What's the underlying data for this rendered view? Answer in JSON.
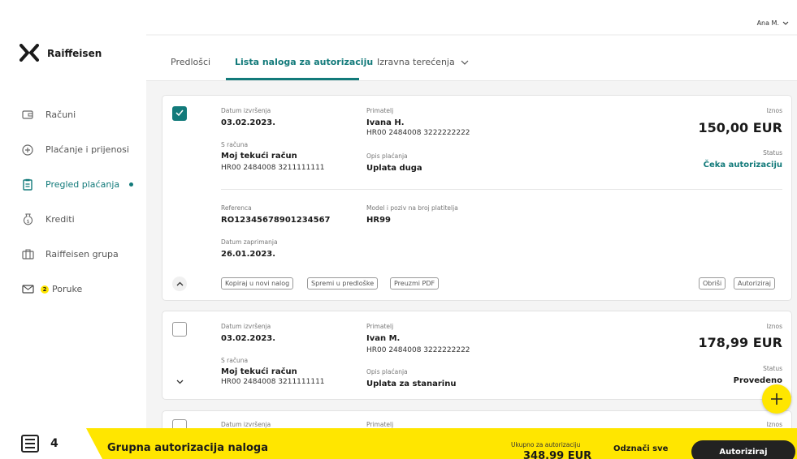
{
  "app": {
    "brand": "Raiffeisen"
  },
  "user": {
    "name": "Ana M."
  },
  "sidebar": {
    "items": [
      {
        "label": "Računi",
        "icon": "wallet-icon"
      },
      {
        "label": "Plaćanje i prijenosi",
        "icon": "plus-circle-icon"
      },
      {
        "label": "Pregled plaćanja",
        "icon": "clipboard-icon",
        "active": true
      },
      {
        "label": "Krediti",
        "icon": "money-bag-icon"
      },
      {
        "label": "Raiffeisen grupa",
        "icon": "briefcase-icon"
      },
      {
        "label": "Poruke",
        "icon": "mail-icon",
        "badge": "2"
      }
    ]
  },
  "tabs": [
    {
      "label": "Predlošci"
    },
    {
      "label": "Lista naloga za autorizaciju",
      "active": true
    },
    {
      "label": "Izravna terećenja"
    }
  ],
  "orders": [
    {
      "checked": true,
      "expanded": true,
      "date_label": "Datum izvršenja",
      "date": "03.02.2023.",
      "from_label": "S računa",
      "from_name": "Moj tekući račun",
      "from_iban": "HR00 2484008 3211111111",
      "payee_label": "Primatelj",
      "payee_name": "Ivana H.",
      "payee_iban": "HR00 2484008 3222222222",
      "desc_label": "Opis plaćanja",
      "desc": "Uplata duga",
      "amount_label": "Iznos",
      "amount": "150,00 EUR",
      "status_label": "Status",
      "status": "Čeka autorizaciju",
      "ref_label": "Referenca",
      "ref": "RO12345678901234567",
      "model_label": "Model i poziv na broj platitelja",
      "model": "HR99",
      "received_label": "Datum zaprimanja",
      "received": "26.01.2023.",
      "actions": {
        "copy": "Kopiraj u novi nalog",
        "save": "Spremi u predloške",
        "pdf": "Preuzmi PDF",
        "delete": "Obriši",
        "authorize": "Autoriziraj"
      }
    },
    {
      "checked": false,
      "expanded": false,
      "date_label": "Datum izvršenja",
      "date": "03.02.2023.",
      "from_label": "S računa",
      "from_name": "Moj tekući račun",
      "from_iban": "HR00 2484008 3211111111",
      "payee_label": "Primatelj",
      "payee_name": "Ivan M.",
      "payee_iban": "HR00 2484008 3222222222",
      "desc_label": "Opis plaćanja",
      "desc": "Uplata za stanarinu",
      "amount_label": "Iznos",
      "amount": "178,99 EUR",
      "status_label": "Status",
      "status": "Provedeno"
    },
    {
      "checked": false,
      "date_label": "Datum izvršenja",
      "payee_label": "Primatelj",
      "amount_label": "Iznos"
    }
  ],
  "bottom_bar": {
    "count": "4",
    "title": "Grupna autorizacija naloga",
    "total_label": "Ukupno za autorizaciju",
    "total": "348,99 EUR",
    "unmark": "Odznači sve",
    "authorize": "Autoriziraj"
  },
  "colors": {
    "accent": "#127a7a",
    "yellow": "#ffe600",
    "dark": "#222222"
  }
}
